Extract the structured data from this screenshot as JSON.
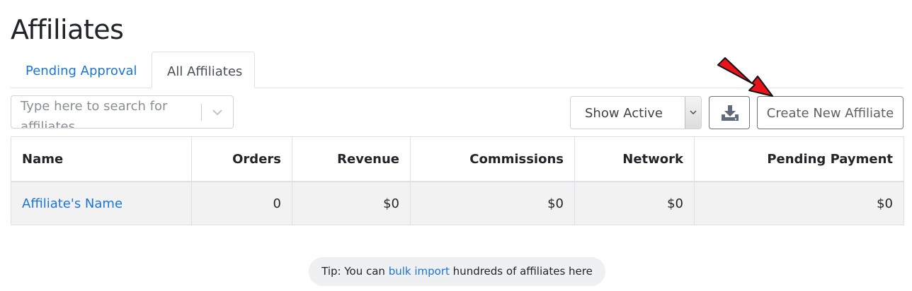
{
  "page": {
    "title": "Affiliates"
  },
  "tabs": [
    {
      "label": "Pending Approval",
      "active": false
    },
    {
      "label": "All Affiliates",
      "active": true
    }
  ],
  "toolbar": {
    "search_placeholder": "Type here to search for affiliates",
    "filter_selected": "Show Active",
    "download_icon": "download-tray-icon",
    "create_label": "Create New Affiliate"
  },
  "table": {
    "columns": [
      "Name",
      "Orders",
      "Revenue",
      "Commissions",
      "Network",
      "Pending Payment"
    ],
    "rows": [
      {
        "name": "Affiliate's Name",
        "orders": "0",
        "revenue": "$0",
        "commissions": "$0",
        "network": "$0",
        "pending_payment": "$0"
      }
    ]
  },
  "tip": {
    "prefix": "Tip: You can ",
    "link": "bulk import",
    "suffix": " hundreds of affiliates here"
  },
  "colors": {
    "link": "#1b74d8",
    "annotation_arrow": "#e8141c"
  }
}
